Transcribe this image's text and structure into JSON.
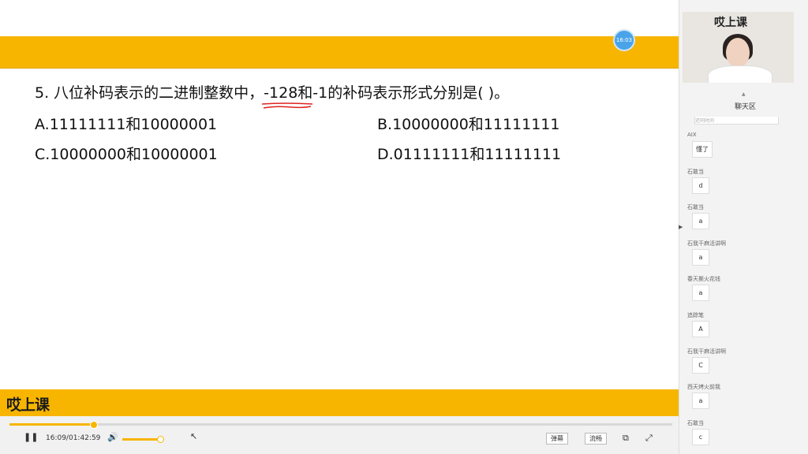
{
  "slide": {
    "time_bubble": "16:03",
    "question_prefix": "5. 八位补码表示的二进制整数中，",
    "question_highlight": "-128",
    "question_suffix": "和-1的补码表示形式分别是(      )。",
    "options": {
      "a": "A.11111111和10000001",
      "b": "B.10000000和11111111",
      "c": "C.10000000和10000001",
      "d": "D.01111111和11111111"
    },
    "logo": "哎上课"
  },
  "player": {
    "progress": 0.126,
    "time": "16:09/01:42:59",
    "volume": 0.95,
    "danmu_label": "弹幕",
    "quality_label": "流畅",
    "pause_icon": "pause-icon",
    "volume_icon": "volume-icon",
    "pip_icon": "pip-icon",
    "fullscreen_icon": "fullscreen-icon"
  },
  "sidebar": {
    "video_logo": "哎上课",
    "chat_title": "聊天区",
    "chat_clipped": "还同时间",
    "messages": [
      {
        "name": "AIX",
        "text": "懂了"
      },
      {
        "name": "石敢当",
        "text": "d"
      },
      {
        "name": "石敢当",
        "text": "a"
      },
      {
        "name": "石我干麻活讲啊",
        "text": "a"
      },
      {
        "name": "春天撕火花钱",
        "text": "a"
      },
      {
        "name": "追踪笔",
        "text": "A"
      },
      {
        "name": "石我干麻活讲啊",
        "text": "C"
      },
      {
        "name": "西天烤火前我",
        "text": "a"
      },
      {
        "name": "石敢当",
        "text": "c"
      }
    ]
  }
}
